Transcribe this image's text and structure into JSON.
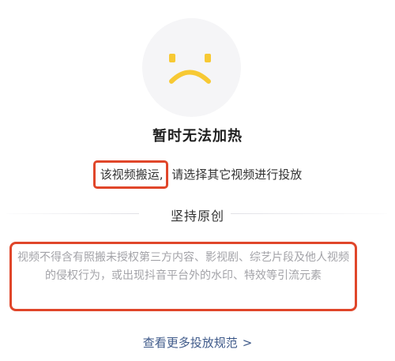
{
  "colors": {
    "accent_emoji": "#f7c934",
    "highlight_border": "#e0462a",
    "link": "#3f5a8a",
    "muted_text": "#a3a3a8"
  },
  "icon": {
    "name": "sad-face-icon"
  },
  "title": "暂时无法加热",
  "message": {
    "highlighted": "该视频搬运,",
    "rest": " 请选择其它视频进行投放"
  },
  "section_title": "坚持原创",
  "description": "视频不得含有照搬未授权第三方内容、影视剧、综艺片段及他人视频的侵权行为，或出现抖音平台外的水印、特效等引流元素",
  "more_link": {
    "label": "查看更多投放规范",
    "chevron": ">"
  }
}
